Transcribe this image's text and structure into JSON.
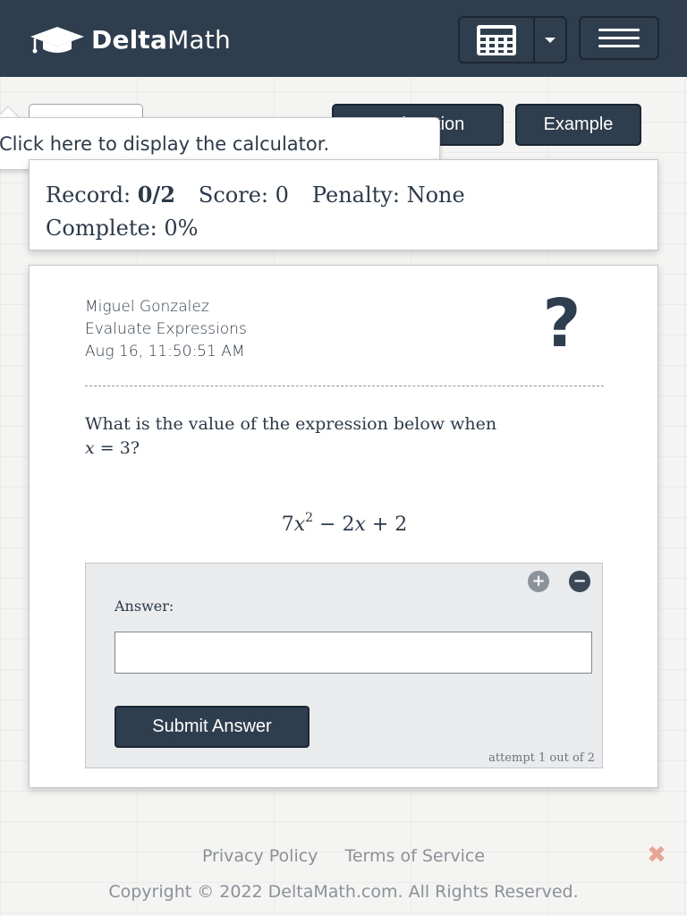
{
  "navbar": {
    "brand_bold": "Delta",
    "brand_light": "Math",
    "logo_icon": "graduation-cap-icon",
    "calculator_icon": "calculator-icon",
    "menu_icon": "hamburger-menu-icon",
    "background_color": "#2f3e4e"
  },
  "toolbar": {
    "explanation_label": "Explanation",
    "example_label": "Example"
  },
  "tooltip": {
    "text": "Click here to display the calculator."
  },
  "record": {
    "record_label": "Record:",
    "record_value": "0/2",
    "score_label": "Score:",
    "score_value": "0",
    "penalty_label": "Penalty:",
    "penalty_value": "None",
    "complete_label": "Complete:",
    "complete_value": "0%"
  },
  "problem": {
    "student_name": "Miguel Gonzalez",
    "topic": "Evaluate Expressions",
    "timestamp": "Aug 16, 11:50:51 AM",
    "help_icon": "question-mark-icon",
    "question_text": "What is the value of the expression below when",
    "variable": "x",
    "equals": "=",
    "value": "3?",
    "expression": {
      "coef": "7",
      "var1": "x",
      "exp": "2",
      "middle": " − 2",
      "var2": "x",
      "tail": " + 2"
    }
  },
  "answer": {
    "label": "Answer:",
    "input_value": "",
    "submit_label": "Submit Answer",
    "attempt_text": "attempt 1 out of 2",
    "zoom_in_symbol": "+",
    "zoom_out_symbol": "−"
  },
  "footer": {
    "privacy_label": "Privacy Policy",
    "terms_label": "Terms of Service",
    "close_symbol": "✖",
    "copyright": "Copyright © 2022 DeltaMath.com. All Rights Reserved."
  }
}
